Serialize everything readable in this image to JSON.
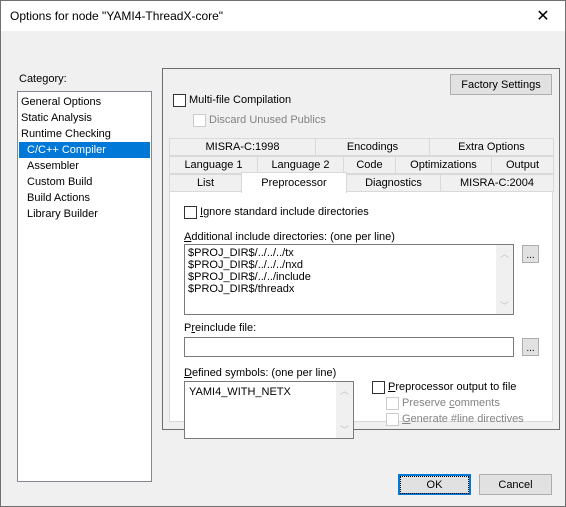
{
  "window": {
    "title": "Options for node \"YAMI4-ThreadX-core\"",
    "close_glyph": "✕"
  },
  "category": {
    "label": "Category:",
    "items": [
      {
        "label": "General Options",
        "indent": false,
        "selected": false
      },
      {
        "label": "Static Analysis",
        "indent": false,
        "selected": false
      },
      {
        "label": "Runtime Checking",
        "indent": false,
        "selected": false
      },
      {
        "label": "C/C++ Compiler",
        "indent": true,
        "selected": true
      },
      {
        "label": "Assembler",
        "indent": true,
        "selected": false
      },
      {
        "label": "Custom Build",
        "indent": true,
        "selected": false
      },
      {
        "label": "Build Actions",
        "indent": true,
        "selected": false
      },
      {
        "label": "Library Builder",
        "indent": true,
        "selected": false
      }
    ]
  },
  "panel": {
    "factory_settings": "Factory Settings",
    "multi_file": {
      "label": "Multi-file Compilation",
      "checked": false
    },
    "discard_unused": {
      "label": "Discard Unused Publics",
      "checked": false,
      "disabled": true
    },
    "tabs": {
      "row1": [
        "MISRA-C:1998",
        "Encodings",
        "Extra Options"
      ],
      "row2": [
        "Language 1",
        "Language 2",
        "Code",
        "Optimizations",
        "Output"
      ],
      "row3": [
        "List",
        "Preprocessor",
        "Diagnostics",
        "MISRA-C:2004"
      ],
      "active": "Preprocessor"
    }
  },
  "preprocessor": {
    "ignore_std": {
      "label_accel": "I",
      "label_rest": "gnore standard include directories",
      "checked": false
    },
    "include_dirs": {
      "label_accel": "A",
      "label_rest": "dditional include directories: (one per line)",
      "lines": [
        "$PROJ_DIR$/../../../tx",
        "$PROJ_DIR$/../../../nxd",
        "$PROJ_DIR$/../../include",
        "$PROJ_DIR$/threadx"
      ]
    },
    "preinclude": {
      "label_pre": "P",
      "label_accel": "r",
      "label_rest": "einclude file:",
      "value": ""
    },
    "defined_symbols": {
      "label_accel": "D",
      "label_rest": "efined symbols: (one per line)",
      "lines": [
        "YAMI4_WITH_NETX"
      ]
    },
    "output_to_file": {
      "label_accel": "P",
      "label_rest": "reprocessor output to file",
      "checked": false
    },
    "preserve_comments": {
      "label_pre": "Preserve ",
      "label_accel": "c",
      "label_rest": "omments",
      "checked": false,
      "disabled": true
    },
    "generate_line": {
      "label_accel": "G",
      "label_rest": "enerate #line directives",
      "checked": false,
      "disabled": true
    },
    "browse_label": "..."
  },
  "footer": {
    "ok": "OK",
    "cancel": "Cancel"
  },
  "colors": {
    "accent": "#0078d7",
    "disabled_text": "#838383"
  }
}
